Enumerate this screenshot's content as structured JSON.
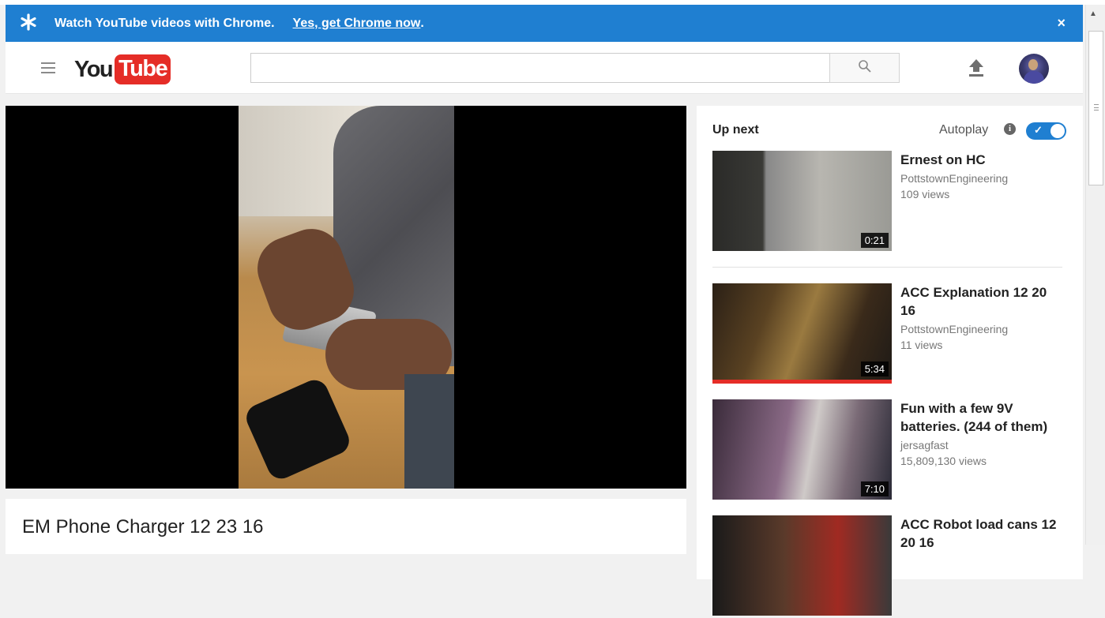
{
  "banner": {
    "message": "Watch YouTube videos with Chrome.",
    "cta": "Yes, get Chrome now",
    "cta_suffix": ".",
    "close": "×",
    "color": "#1f7fd1"
  },
  "masthead": {
    "logo_you": "You",
    "logo_tube": "Tube",
    "search_placeholder": "",
    "search_value": "",
    "brand_color": "#e52d27"
  },
  "player": {
    "title": "EM Phone Charger 12 23 16"
  },
  "sidebar": {
    "up_next": "Up next",
    "autoplay": "Autoplay",
    "autoplay_on": true,
    "videos": [
      {
        "title": "Ernest on HC",
        "channel": "PottstownEngineering",
        "views": "109 views",
        "duration": "0:21"
      },
      {
        "title": "ACC Explanation 12 20 16",
        "channel": "PottstownEngineering",
        "views": "11 views",
        "duration": "5:34",
        "watched": true
      },
      {
        "title": "Fun with a few 9V batteries. (244 of them)",
        "channel": "jersagfast",
        "views": "15,809,130 views",
        "duration": "7:10"
      },
      {
        "title": "ACC Robot load cans 12 20 16",
        "channel": "",
        "views": "",
        "duration": ""
      }
    ]
  },
  "icons": [
    "star-icon",
    "close-icon",
    "menu-icon",
    "search-icon",
    "upload-icon",
    "info-icon",
    "check-icon"
  ]
}
